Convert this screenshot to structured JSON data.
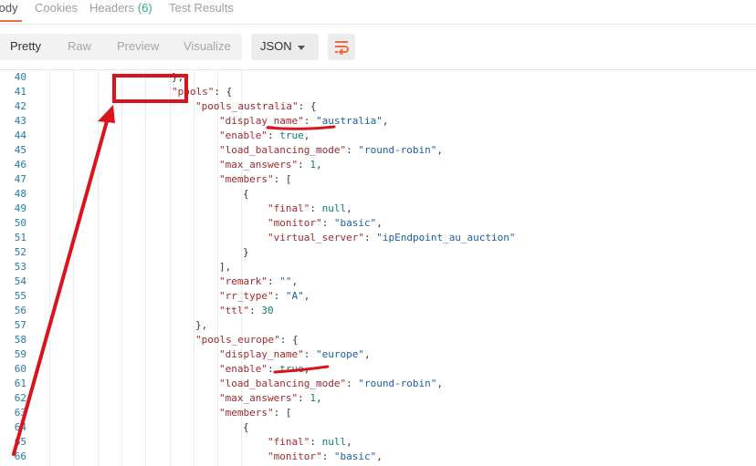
{
  "tabs": [
    {
      "label": "Body"
    },
    {
      "label": "Cookies"
    },
    {
      "label": "Headers",
      "count": "(6)"
    },
    {
      "label": "Test Results"
    }
  ],
  "toolbar": {
    "views": [
      "Pretty",
      "Raw",
      "Preview",
      "Visualize"
    ],
    "format": "JSON",
    "wrap_icon": "wrap-lines-icon"
  },
  "code": {
    "lines": [
      {
        "n": "40",
        "indent": 5,
        "tokens": [
          [
            "p",
            "},"
          ]
        ]
      },
      {
        "n": "41",
        "indent": 5,
        "tokens": [
          [
            "k",
            "\"pools\""
          ],
          [
            "p",
            ": {"
          ]
        ]
      },
      {
        "n": "42",
        "indent": 6,
        "tokens": [
          [
            "k",
            "\"pools_australia\""
          ],
          [
            "p",
            ": {"
          ]
        ]
      },
      {
        "n": "43",
        "indent": 7,
        "tokens": [
          [
            "k",
            "\"display_name\""
          ],
          [
            "p",
            ": "
          ],
          [
            "s",
            "\"australia\""
          ],
          [
            "p",
            ","
          ]
        ]
      },
      {
        "n": "44",
        "indent": 7,
        "tokens": [
          [
            "k",
            "\"enable\""
          ],
          [
            "p",
            ": "
          ],
          [
            "n",
            "true"
          ],
          [
            "p",
            ","
          ]
        ]
      },
      {
        "n": "45",
        "indent": 7,
        "tokens": [
          [
            "k",
            "\"load_balancing_mode\""
          ],
          [
            "p",
            ": "
          ],
          [
            "s",
            "\"round-robin\""
          ],
          [
            "p",
            ","
          ]
        ]
      },
      {
        "n": "46",
        "indent": 7,
        "tokens": [
          [
            "k",
            "\"max_answers\""
          ],
          [
            "p",
            ": "
          ],
          [
            "n",
            "1"
          ],
          [
            "p",
            ","
          ]
        ]
      },
      {
        "n": "47",
        "indent": 7,
        "tokens": [
          [
            "k",
            "\"members\""
          ],
          [
            "p",
            ": ["
          ]
        ]
      },
      {
        "n": "48",
        "indent": 8,
        "tokens": [
          [
            "p",
            "{"
          ]
        ]
      },
      {
        "n": "49",
        "indent": 9,
        "tokens": [
          [
            "k",
            "\"final\""
          ],
          [
            "p",
            ": "
          ],
          [
            "n",
            "null"
          ],
          [
            "p",
            ","
          ]
        ]
      },
      {
        "n": "50",
        "indent": 9,
        "tokens": [
          [
            "k",
            "\"monitor\""
          ],
          [
            "p",
            ": "
          ],
          [
            "s",
            "\"basic\""
          ],
          [
            "p",
            ","
          ]
        ]
      },
      {
        "n": "51",
        "indent": 9,
        "tokens": [
          [
            "k",
            "\"virtual_server\""
          ],
          [
            "p",
            ": "
          ],
          [
            "s",
            "\"ipEndpoint_au_auction\""
          ]
        ]
      },
      {
        "n": "52",
        "indent": 8,
        "tokens": [
          [
            "p",
            "}"
          ]
        ]
      },
      {
        "n": "53",
        "indent": 7,
        "tokens": [
          [
            "p",
            "],"
          ]
        ]
      },
      {
        "n": "54",
        "indent": 7,
        "tokens": [
          [
            "k",
            "\"remark\""
          ],
          [
            "p",
            ": "
          ],
          [
            "s",
            "\"\""
          ],
          [
            "p",
            ","
          ]
        ]
      },
      {
        "n": "55",
        "indent": 7,
        "tokens": [
          [
            "k",
            "\"rr_type\""
          ],
          [
            "p",
            ": "
          ],
          [
            "s",
            "\"A\""
          ],
          [
            "p",
            ","
          ]
        ]
      },
      {
        "n": "56",
        "indent": 7,
        "tokens": [
          [
            "k",
            "\"ttl\""
          ],
          [
            "p",
            ": "
          ],
          [
            "n",
            "30"
          ]
        ]
      },
      {
        "n": "57",
        "indent": 6,
        "tokens": [
          [
            "p",
            "},"
          ]
        ]
      },
      {
        "n": "58",
        "indent": 6,
        "tokens": [
          [
            "k",
            "\"pools_europe\""
          ],
          [
            "p",
            ": {"
          ]
        ]
      },
      {
        "n": "59",
        "indent": 7,
        "tokens": [
          [
            "k",
            "\"display_name\""
          ],
          [
            "p",
            ": "
          ],
          [
            "s",
            "\"europe\""
          ],
          [
            "p",
            ","
          ]
        ]
      },
      {
        "n": "60",
        "indent": 7,
        "tokens": [
          [
            "k",
            "\"enable\""
          ],
          [
            "p",
            ": "
          ],
          [
            "n",
            "true"
          ],
          [
            "p",
            ","
          ]
        ]
      },
      {
        "n": "61",
        "indent": 7,
        "tokens": [
          [
            "k",
            "\"load_balancing_mode\""
          ],
          [
            "p",
            ": "
          ],
          [
            "s",
            "\"round-robin\""
          ],
          [
            "p",
            ","
          ]
        ]
      },
      {
        "n": "62",
        "indent": 7,
        "tokens": [
          [
            "k",
            "\"max_answers\""
          ],
          [
            "p",
            ": "
          ],
          [
            "n",
            "1"
          ],
          [
            "p",
            ","
          ]
        ]
      },
      {
        "n": "63",
        "indent": 7,
        "tokens": [
          [
            "k",
            "\"members\""
          ],
          [
            "p",
            ": ["
          ]
        ]
      },
      {
        "n": "64",
        "indent": 8,
        "tokens": [
          [
            "p",
            "{"
          ]
        ]
      },
      {
        "n": "65",
        "indent": 9,
        "tokens": [
          [
            "k",
            "\"final\""
          ],
          [
            "p",
            ": "
          ],
          [
            "n",
            "null"
          ],
          [
            "p",
            ","
          ]
        ]
      },
      {
        "n": "66",
        "indent": 9,
        "tokens": [
          [
            "k",
            "\"monitor\""
          ],
          [
            "p",
            ": "
          ],
          [
            "s",
            "\"basic\""
          ],
          [
            "p",
            ","
          ]
        ]
      }
    ]
  },
  "annotation": {
    "color": "#d9141b"
  }
}
